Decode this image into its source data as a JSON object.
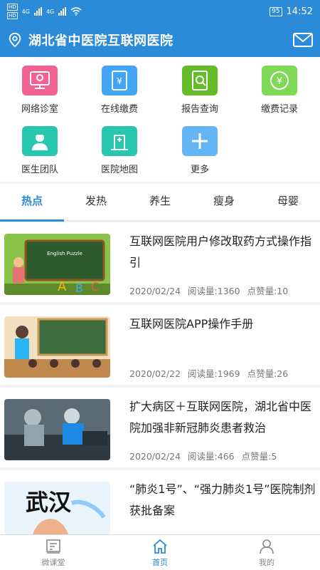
{
  "status_bar": {
    "sim1": "HD",
    "sim2": "HD",
    "net1": "4G",
    "net2": "4G",
    "battery": "95",
    "time": "14:52"
  },
  "header": {
    "title": "湖北省中医院互联网医院",
    "location_icon": "location-pin-icon",
    "mail_icon": "mail-icon"
  },
  "grid": [
    {
      "label": "网络诊室",
      "icon": "online-clinic-icon",
      "color": "#f06292"
    },
    {
      "label": "在线缴费",
      "icon": "online-payment-icon",
      "color": "#42a5f5"
    },
    {
      "label": "报告查询",
      "icon": "report-query-icon",
      "color": "#66bb2a"
    },
    {
      "label": "缴费记录",
      "icon": "payment-record-icon",
      "color": "#7ed957"
    },
    {
      "label": "医生团队",
      "icon": "doctor-team-icon",
      "color": "#26c6b0"
    },
    {
      "label": "医院地图",
      "icon": "hospital-map-icon",
      "color": "#26c6b0"
    },
    {
      "label": "更多",
      "icon": "more-plus-icon",
      "color": "#64b5f6"
    }
  ],
  "tabs": [
    "热点",
    "发热",
    "养生",
    "瘦身",
    "母婴"
  ],
  "active_tab": "热点",
  "articles": [
    {
      "title": "互联网医院用户修改取药方式操作指引",
      "date": "2020/02/24",
      "reads": "阅读量:1360",
      "likes": "点赞量:10",
      "thumb_text": "English Puzzle"
    },
    {
      "title": "互联网医院APP操作手册",
      "date": "2020/02/22",
      "reads": "阅读量:1969",
      "likes": "点赞量:26"
    },
    {
      "title": "扩大病区＋互联网医院，湖北省中医院加强非新冠肺炎患者救治",
      "date": "2020/02/24",
      "reads": "阅读量:466",
      "likes": "点赞量:5"
    },
    {
      "title": "“肺炎1号”、“强力肺炎1号”医院制剂获批备案",
      "thumb_text": "武汉"
    }
  ],
  "bottom_nav": [
    {
      "label": "微课堂",
      "icon": "micro-class-icon"
    },
    {
      "label": "首页",
      "icon": "home-icon"
    },
    {
      "label": "我的",
      "icon": "profile-icon"
    }
  ],
  "colors": {
    "primary": "#2b8bd9",
    "text": "#222222",
    "meta": "#777777"
  }
}
